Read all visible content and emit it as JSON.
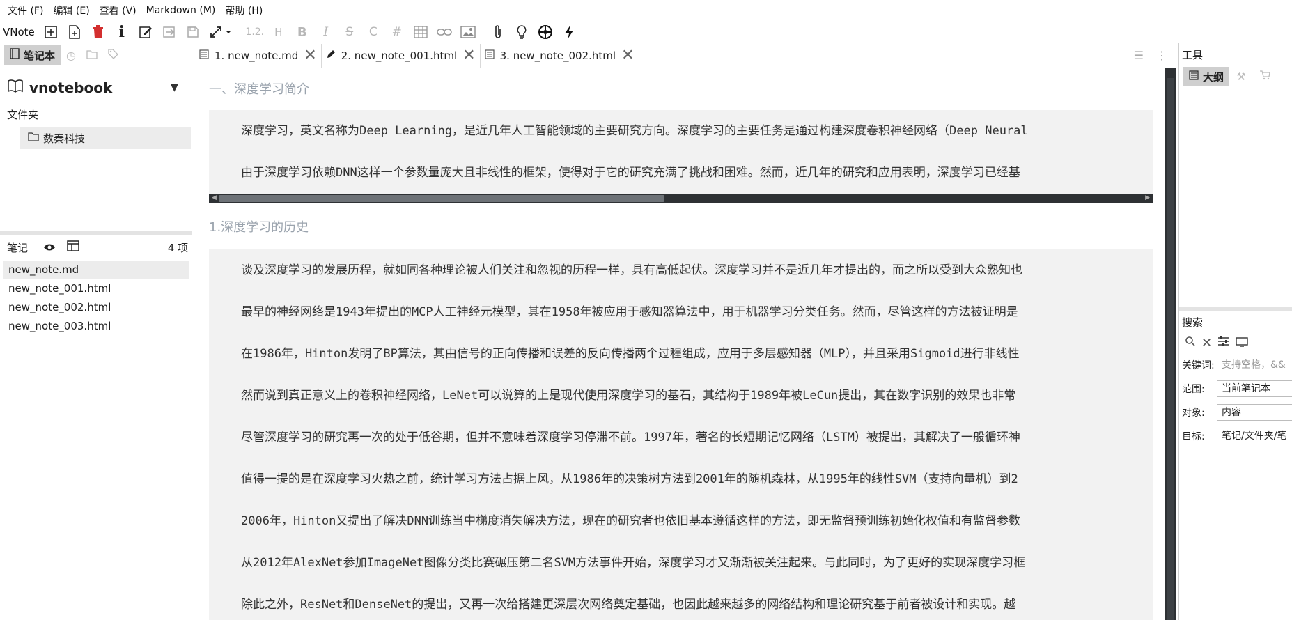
{
  "menubar": [
    "文件 (F)",
    "编辑 (E)",
    "查看 (V)",
    "Markdown (M)",
    "帮助 (H)"
  ],
  "toolbar": {
    "app_label": "VNote",
    "heading_level": "1.2.",
    "heading_h": "H",
    "bold": "B",
    "italic": "I",
    "strike": "S",
    "code": "C",
    "hash": "#"
  },
  "left": {
    "tab_active": "笔记本",
    "notebook": "vnotebook",
    "folder_label": "文件夹",
    "folder": "数秦科技",
    "notes_label": "笔记",
    "notes_count": "4 项",
    "notes": [
      "new_note.md",
      "new_note_001.html",
      "new_note_002.html",
      "new_note_003.html"
    ]
  },
  "tabs": [
    "1. new_note.md",
    "2. new_note_001.html",
    "3. new_note_002.html"
  ],
  "editor": {
    "h1": "一、深度学习简介",
    "block1": [
      "深度学习，英文名称为Deep Learning，是近几年人工智能领域的主要研究方向。深度学习的主要任务是通过构建深度卷积神经网络（Deep Neural",
      "由于深度学习依赖DNN这样一个参数量庞大且非线性的框架，使得对于它的研究充满了挑战和困难。然而，近几年的研究和应用表明，深度学习已经基"
    ],
    "h2": "1.深度学习的历史",
    "block2": [
      "谈及深度学习的发展历程，就如同各种理论被人们关注和忽视的历程一样，具有高低起伏。深度学习并不是近几年才提出的，而之所以受到大众熟知也",
      "最早的神经网络是1943年提出的MCP人工神经元模型，其在1958年被应用于感知器算法中，用于机器学习分类任务。然而，尽管这样的方法被证明是",
      "在1986年，Hinton发明了BP算法，其由信号的正向传播和误差的反向传播两个过程组成，应用于多层感知器（MLP），并且采用Sigmoid进行非线性",
      "然而说到真正意义上的卷积神经网络，LeNet可以说算的上是现代使用深度学习的基石，其结构于1989年被LeCun提出，其在数字识别的效果也非常",
      "尽管深度学习的研究再一次的处于低谷期，但并不意味着深度学习停滞不前。1997年，著名的长短期记忆网络（LSTM）被提出，其解决了一般循环神",
      "值得一提的是在深度学习火热之前，统计学习方法占据上风，从1986年的决策树方法到2001年的随机森林，从1995年的线性SVM（支持向量机）到2",
      "2006年，Hinton又提出了解决DNN训练当中梯度消失解决方法，现在的研究者也依旧基本遵循这样的方法，即无监督预训练初始化权值和有监督参数",
      "从2012年AlexNet参加ImageNet图像分类比赛碾压第二名SVM方法事件开始，深度学习才又渐渐被关注起来。与此同时，为了更好的实现深度学习框",
      "除此之外，ResNet和DenseNet的提出，又再一次给搭建更深层次网络奠定基础，也因此越来越多的网络结构和理论研究基于前者被设计和实现。越"
    ]
  },
  "right": {
    "tools_title": "工具",
    "outline_tab": "大纲",
    "search_title": "搜索",
    "keyword_label": "关键词:",
    "keyword_placeholder": "支持空格，&&",
    "scope_label": "范围:",
    "scope_value": "当前笔记本",
    "object_label": "对象:",
    "object_value": "内容",
    "target_label": "目标:",
    "target_value": "笔记/文件夹/笔"
  }
}
